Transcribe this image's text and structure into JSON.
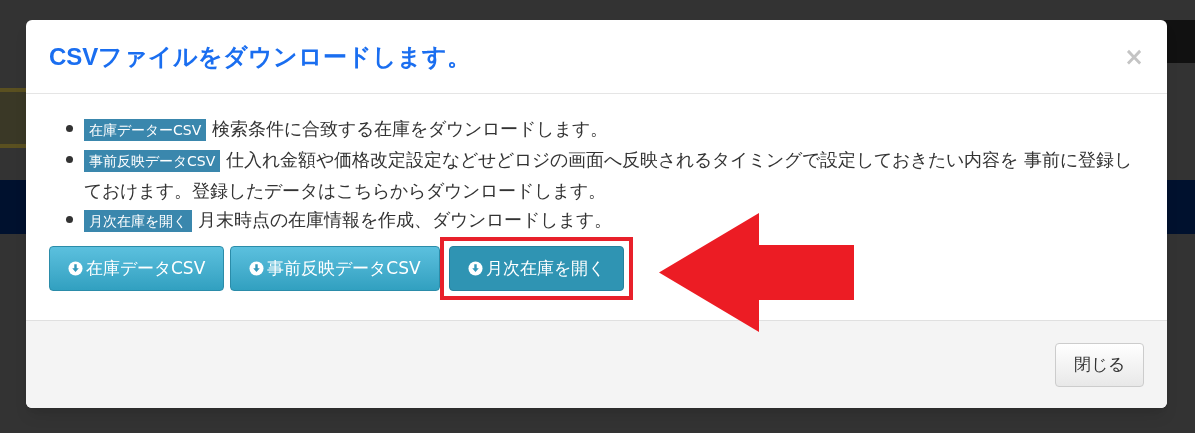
{
  "modal": {
    "title": "CSVファイルをダウンロードします。",
    "close": "×",
    "items": [
      {
        "label": "在庫データーCSV",
        "text": "検索条件に合致する在庫をダウンロードします。"
      },
      {
        "label": "事前反映データCSV",
        "text": "仕入れ金額や価格改定設定などせどロジの画面へ反映されるタイミングで設定しておきたい内容を 事前に登録しておけます。登録したデータはこちらからダウンロードします。"
      },
      {
        "label": "月次在庫を開く",
        "text": "月末時点の在庫情報を作成、ダウンロードします。"
      }
    ],
    "buttons": [
      {
        "label": "在庫データCSV",
        "selected": false
      },
      {
        "label": "事前反映データCSV",
        "selected": false
      },
      {
        "label": "月次在庫を開く",
        "selected": true
      }
    ],
    "footer_button": "閉じる"
  }
}
